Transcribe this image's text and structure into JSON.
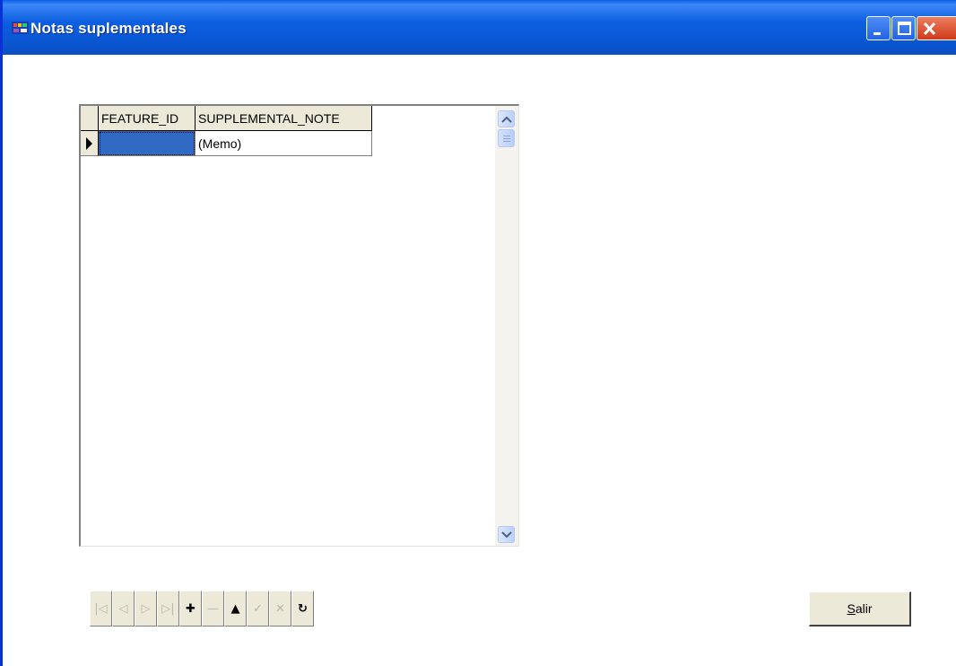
{
  "window": {
    "title": "Notas suplementales"
  },
  "grid": {
    "columns": [
      "FEATURE_ID",
      "SUPPLEMENTAL_NOTE"
    ],
    "rows": [
      {
        "feature_id": "",
        "supplemental_note": "(Memo)"
      }
    ]
  },
  "navigator": {
    "buttons": [
      {
        "name": "first-record-button",
        "icon": "first-icon",
        "glyph": "|◁",
        "enabled": false
      },
      {
        "name": "prior-record-button",
        "icon": "prior-icon",
        "glyph": "◁",
        "enabled": false
      },
      {
        "name": "next-record-button",
        "icon": "next-icon",
        "glyph": "▷",
        "enabled": false
      },
      {
        "name": "last-record-button",
        "icon": "last-icon",
        "glyph": "▷|",
        "enabled": false
      },
      {
        "name": "insert-record-button",
        "icon": "plus-icon",
        "glyph": "✚",
        "enabled": true
      },
      {
        "name": "delete-record-button",
        "icon": "minus-icon",
        "glyph": "—",
        "enabled": false
      },
      {
        "name": "edit-record-button",
        "icon": "up-triangle-icon",
        "glyph": "▲",
        "enabled": true
      },
      {
        "name": "post-record-button",
        "icon": "check-icon",
        "glyph": "✓",
        "enabled": false
      },
      {
        "name": "cancel-record-button",
        "icon": "x-icon",
        "glyph": "✕",
        "enabled": false
      },
      {
        "name": "refresh-record-button",
        "icon": "refresh-icon",
        "glyph": "↻",
        "enabled": true
      }
    ]
  },
  "exit_button": {
    "label_first": "S",
    "label_rest": "alir"
  },
  "colors": {
    "titlebar": "#0a5ee6",
    "selection": "#316ac5",
    "face": "#ece9d8"
  }
}
